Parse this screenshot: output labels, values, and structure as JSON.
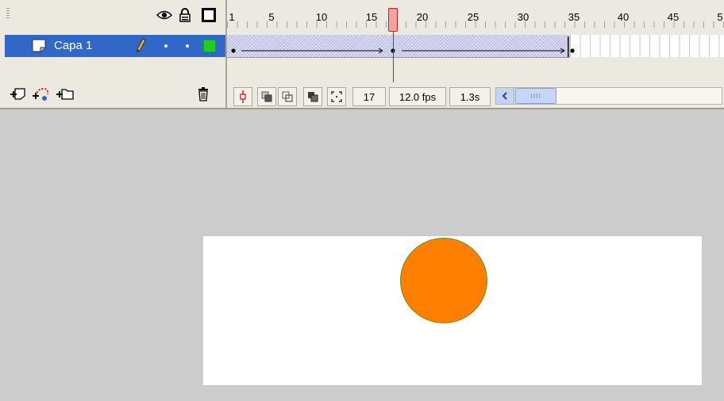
{
  "timeline": {
    "layer": {
      "name": "Capa 1"
    },
    "ruler": [
      "1",
      "5",
      "10",
      "15",
      "20",
      "25",
      "30",
      "35",
      "40",
      "45",
      "5"
    ],
    "status": {
      "frame": "17",
      "fps": "12.0 fps",
      "time": "1.3s"
    },
    "scroll_thumb": "IIII"
  },
  "stage": {
    "shape_color": "#ff7f00"
  },
  "colors": {
    "selection": "#3168c8",
    "playhead": "#d21a1a",
    "outline_green": "#22cc22"
  }
}
